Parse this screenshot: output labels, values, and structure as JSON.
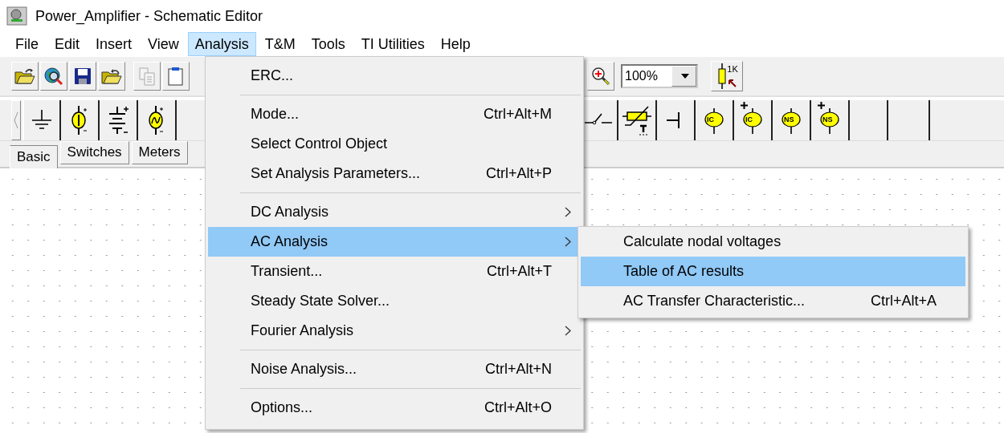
{
  "window": {
    "title": "Power_Amplifier - Schematic Editor"
  },
  "menu_bar": [
    {
      "label": "File",
      "selected": false
    },
    {
      "label": "Edit",
      "selected": false
    },
    {
      "label": "Insert",
      "selected": false
    },
    {
      "label": "View",
      "selected": false
    },
    {
      "label": "Analysis",
      "selected": true
    },
    {
      "label": "T&M",
      "selected": false
    },
    {
      "label": "Tools",
      "selected": false
    },
    {
      "label": "TI Utilities",
      "selected": false
    },
    {
      "label": "Help",
      "selected": false
    }
  ],
  "toolbar": {
    "zoom": "100%",
    "resistor_label": "1K"
  },
  "parts_bar": {
    "probes": [
      {
        "label": "IC",
        "plus": false
      },
      {
        "label": "IC",
        "plus": true
      },
      {
        "label": "NS",
        "plus": false
      },
      {
        "label": "NS",
        "plus": true
      }
    ]
  },
  "part_tabs": [
    {
      "label": "Basic",
      "selected": true
    },
    {
      "label": "Switches",
      "selected": false
    },
    {
      "label": "Meters",
      "selected": false
    }
  ],
  "analysis_menu": [
    {
      "kind": "item",
      "label": "ERC...",
      "selected": false
    },
    {
      "kind": "separator"
    },
    {
      "kind": "item",
      "label": "Mode...",
      "shortcut": "Ctrl+Alt+M",
      "selected": false
    },
    {
      "kind": "item",
      "label": "Select Control Object",
      "selected": false
    },
    {
      "kind": "item",
      "label": "Set Analysis Parameters...",
      "shortcut": "Ctrl+Alt+P",
      "selected": false
    },
    {
      "kind": "separator"
    },
    {
      "kind": "item",
      "label": "DC Analysis",
      "submenu": true,
      "selected": false
    },
    {
      "kind": "item",
      "label": "AC Analysis",
      "submenu": true,
      "selected": true
    },
    {
      "kind": "item",
      "label": "Transient...",
      "shortcut": "Ctrl+Alt+T",
      "selected": false
    },
    {
      "kind": "item",
      "label": "Steady State Solver...",
      "selected": false
    },
    {
      "kind": "item",
      "label": "Fourier Analysis",
      "submenu": true,
      "selected": false
    },
    {
      "kind": "separator"
    },
    {
      "kind": "item",
      "label": "Noise Analysis...",
      "shortcut": "Ctrl+Alt+N",
      "selected": false
    },
    {
      "kind": "separator"
    },
    {
      "kind": "item",
      "label": "Options...",
      "shortcut": "Ctrl+Alt+O",
      "selected": false
    }
  ],
  "ac_submenu": [
    {
      "kind": "item",
      "label": "Calculate nodal voltages",
      "selected": false
    },
    {
      "kind": "item",
      "label": "Table of AC results",
      "selected": true
    },
    {
      "kind": "item",
      "label": "AC Transfer Characteristic...",
      "shortcut": "Ctrl+Alt+A",
      "selected": false
    }
  ]
}
